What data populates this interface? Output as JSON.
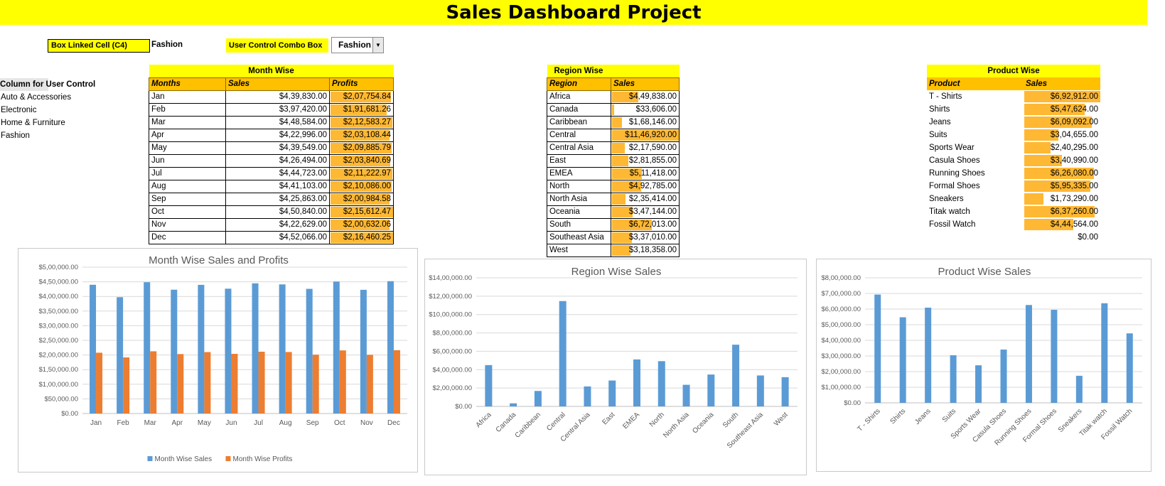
{
  "title": "Sales Dashboard Project",
  "linked_cell": {
    "label": "Box Linked Cell (C4)",
    "value": "Fashion"
  },
  "combo": {
    "label": "User Control Combo Box",
    "selected": "Fashion"
  },
  "user_control": {
    "header": "Column for User Control",
    "items": [
      "Auto & Accessories",
      "Electronic",
      "Home & Furniture",
      "Fashion"
    ]
  },
  "colors": {
    "title_bg": "#ffff00",
    "header_bg": "#ffc000",
    "databar": "#ffb833",
    "sales_series": "#5b9bd5",
    "profit_series": "#ed7d31"
  },
  "month_table": {
    "title": "Month Wise",
    "headers": [
      "Months",
      "Sales",
      "Profits"
    ],
    "rows": [
      {
        "month": "Jan",
        "sales": "$4,39,830.00",
        "profits": "$2,07,754.84"
      },
      {
        "month": "Feb",
        "sales": "$3,97,420.00",
        "profits": "$1,91,681.26"
      },
      {
        "month": "Mar",
        "sales": "$4,48,584.00",
        "profits": "$2,12,583.27"
      },
      {
        "month": "Apr",
        "sales": "$4,22,996.00",
        "profits": "$2,03,108.44"
      },
      {
        "month": "May",
        "sales": "$4,39,549.00",
        "profits": "$2,09,885.79"
      },
      {
        "month": "Jun",
        "sales": "$4,26,494.00",
        "profits": "$2,03,840.69"
      },
      {
        "month": "Jul",
        "sales": "$4,44,723.00",
        "profits": "$2,11,222.97"
      },
      {
        "month": "Aug",
        "sales": "$4,41,103.00",
        "profits": "$2,10,086.00"
      },
      {
        "month": "Sep",
        "sales": "$4,25,863.00",
        "profits": "$2,00,984.58"
      },
      {
        "month": "Oct",
        "sales": "$4,50,840.00",
        "profits": "$2,15,612.47"
      },
      {
        "month": "Nov",
        "sales": "$4,22,629.00",
        "profits": "$2,00,632.06"
      },
      {
        "month": "Dec",
        "sales": "$4,52,066.00",
        "profits": "$2,16,460.25"
      }
    ]
  },
  "region_table": {
    "title": "Region Wise",
    "headers": [
      "Region",
      "Sales"
    ],
    "rows": [
      {
        "region": "Africa",
        "sales": "$4,49,838.00"
      },
      {
        "region": "Canada",
        "sales": "$33,606.00"
      },
      {
        "region": "Caribbean",
        "sales": "$1,68,146.00"
      },
      {
        "region": "Central",
        "sales": "$11,46,920.00"
      },
      {
        "region": "Central Asia",
        "sales": "$2,17,590.00"
      },
      {
        "region": "East",
        "sales": "$2,81,855.00"
      },
      {
        "region": "EMEA",
        "sales": "$5,11,418.00"
      },
      {
        "region": "North",
        "sales": "$4,92,785.00"
      },
      {
        "region": "North Asia",
        "sales": "$2,35,414.00"
      },
      {
        "region": "Oceania",
        "sales": "$3,47,144.00"
      },
      {
        "region": "South",
        "sales": "$6,72,013.00"
      },
      {
        "region": "Southeast Asia",
        "sales": "$3,37,010.00"
      },
      {
        "region": "West",
        "sales": "$3,18,358.00"
      }
    ]
  },
  "product_table": {
    "title": "Product Wise",
    "headers": [
      "Product",
      "Sales"
    ],
    "rows": [
      {
        "product": "T - Shirts",
        "sales": "$6,92,912.00"
      },
      {
        "product": "Shirts",
        "sales": "$5,47,624.00"
      },
      {
        "product": "Jeans",
        "sales": "$6,09,092.00"
      },
      {
        "product": "Suits",
        "sales": "$3,04,655.00"
      },
      {
        "product": "Sports Wear",
        "sales": "$2,40,295.00"
      },
      {
        "product": "Casula Shoes",
        "sales": "$3,40,990.00"
      },
      {
        "product": "Running Shoes",
        "sales": "$6,26,080.00"
      },
      {
        "product": "Formal Shoes",
        "sales": "$5,95,335.00"
      },
      {
        "product": "Sneakers",
        "sales": "$1,73,290.00"
      },
      {
        "product": "Titak watch",
        "sales": "$6,37,260.00"
      },
      {
        "product": "Fossil Watch",
        "sales": "$4,44,564.00"
      }
    ],
    "total": "$0.00"
  },
  "chart_data": [
    {
      "type": "bar",
      "title": "Month Wise Sales and Profits",
      "categories": [
        "Jan",
        "Feb",
        "Mar",
        "Apr",
        "May",
        "Jun",
        "Jul",
        "Aug",
        "Sep",
        "Oct",
        "Nov",
        "Dec"
      ],
      "series": [
        {
          "name": "Month Wise Sales",
          "values": [
            439830,
            397420,
            448584,
            422996,
            439549,
            426494,
            444723,
            441103,
            425863,
            450840,
            422629,
            452066
          ]
        },
        {
          "name": "Month Wise Profits",
          "values": [
            207754.84,
            191681.26,
            212583.27,
            203108.44,
            209885.79,
            203840.69,
            211222.97,
            210086,
            200984.58,
            215612.47,
            200632.06,
            216460.25
          ]
        }
      ],
      "ylim": [
        0,
        500000
      ],
      "yticks": [
        "$0.00",
        "$50,000.00",
        "$1,00,000.00",
        "$1,50,000.00",
        "$2,00,000.00",
        "$2,50,000.00",
        "$3,00,000.00",
        "$3,50,000.00",
        "$4,00,000.00",
        "$4,50,000.00",
        "$5,00,000.00"
      ],
      "grid": true,
      "legend": "bottom"
    },
    {
      "type": "bar",
      "title": "Region Wise Sales",
      "categories": [
        "Africa",
        "Canada",
        "Caribbean",
        "Central",
        "Central Asia",
        "East",
        "EMEA",
        "North",
        "North Asia",
        "Oceania",
        "South",
        "Southeast Asia",
        "West"
      ],
      "values": [
        449838,
        33606,
        168146,
        1146920,
        217590,
        281855,
        511418,
        492785,
        235414,
        347144,
        672013,
        337010,
        318358
      ],
      "ylim": [
        0,
        1400000
      ],
      "yticks": [
        "$0.00",
        "$2,00,000.00",
        "$4,00,000.00",
        "$6,00,000.00",
        "$8,00,000.00",
        "$10,00,000.00",
        "$12,00,000.00",
        "$14,00,000.00"
      ],
      "grid": true
    },
    {
      "type": "bar",
      "title": "Product Wise Sales",
      "categories": [
        "T - Shirts",
        "Shirts",
        "Jeans",
        "Suits",
        "Sports Wear",
        "Casula Shoes",
        "Running Shoes",
        "Formal Shoes",
        "Sneakers",
        "Titak watch",
        "Fossil Watch"
      ],
      "values": [
        692912,
        547624,
        609092,
        304655,
        240295,
        340990,
        626080,
        595335,
        173290,
        637260,
        444564
      ],
      "ylim": [
        0,
        800000
      ],
      "yticks": [
        "$0.00",
        "$1,00,000.00",
        "$2,00,000.00",
        "$3,00,000.00",
        "$4,00,000.00",
        "$5,00,000.00",
        "$6,00,000.00",
        "$7,00,000.00",
        "$8,00,000.00"
      ],
      "grid": true
    }
  ]
}
